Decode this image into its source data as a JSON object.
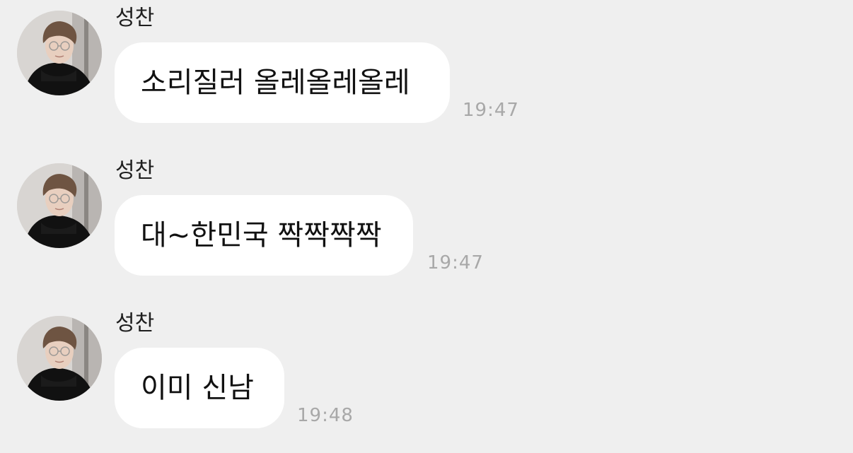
{
  "messages": [
    {
      "sender": "성찬",
      "text": "소리질러 올레올레올레",
      "time": "19:47"
    },
    {
      "sender": "성찬",
      "text": "대~한민국 짝짝짝짝",
      "time": "19:47"
    },
    {
      "sender": "성찬",
      "text": "이미 신남",
      "time": "19:48"
    }
  ],
  "colors": {
    "background": "#efefef",
    "bubble": "#ffffff",
    "timestamp": "#a8a8a8"
  }
}
